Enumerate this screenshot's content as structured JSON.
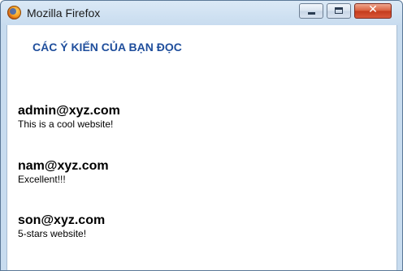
{
  "window": {
    "title": "Mozilla Firefox",
    "app_icon": "firefox-icon",
    "controls": {
      "minimize": "minimize-icon",
      "maximize": "maximize-icon",
      "close_glyph": "✕"
    }
  },
  "page": {
    "heading": "CÁC Ý KIẾN CỦA BẠN ĐỌC",
    "comments": [
      {
        "email": "admin@xyz.com",
        "text": "This is a cool website!"
      },
      {
        "email": "nam@xyz.com",
        "text": "Excellent!!!"
      },
      {
        "email": "son@xyz.com",
        "text": "5-stars website!"
      }
    ]
  }
}
